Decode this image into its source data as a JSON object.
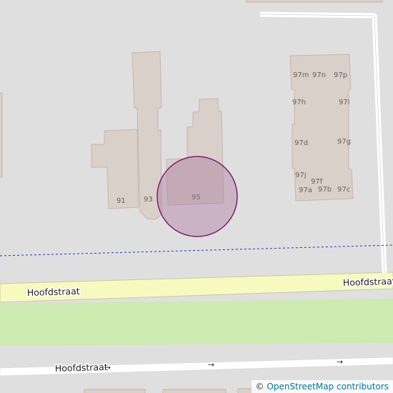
{
  "map": {
    "colors": {
      "background": "#e0dfdf",
      "building_fill": "#d9d0c9",
      "building_stroke": "#c4b6ab",
      "road_fill": "#f7fabf",
      "road_casing": "#c7c9a2",
      "footway": "#ffffff",
      "grass": "#cdebb0",
      "boundary_dashed": "#2233cc",
      "marker_fill": "#a8709a",
      "marker_stroke": "#7a1f6a"
    },
    "house_numbers": {
      "n91": "91",
      "n93": "93",
      "n95": "95",
      "n97m": "97m",
      "n97n": "97n",
      "n97p": "97p",
      "n97h": "97h",
      "n97l": "97l",
      "n97d": "97d",
      "n97g": "97g",
      "n97j": "97j",
      "n97f": "97f",
      "n97a": "97a",
      "n97b": "97b",
      "n97c": "97c"
    },
    "streets": {
      "main_left": "Hoofdstraat",
      "main_right": "Hoofdstraat",
      "bottom": "Hoofdstraat"
    },
    "oneway_arrow": "→",
    "attribution": {
      "copyright": "©",
      "link_text": "OpenStreetMap contributors"
    }
  }
}
